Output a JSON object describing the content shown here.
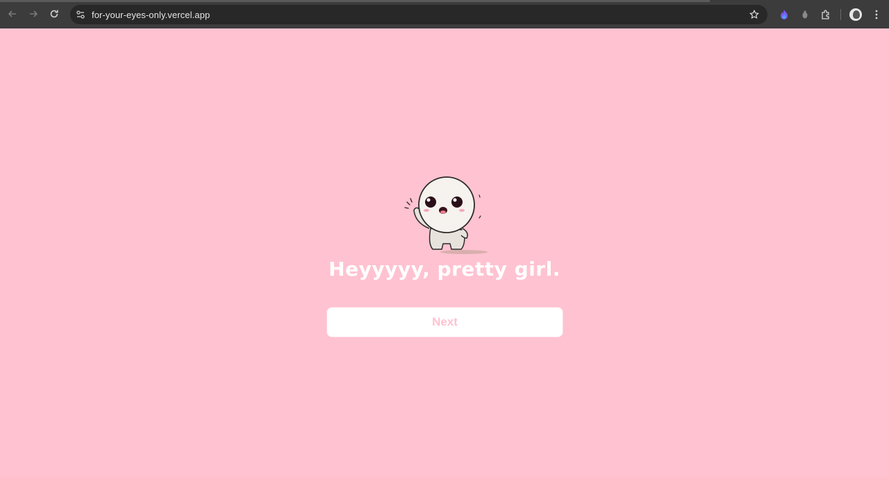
{
  "browser": {
    "url": "for-your-eyes-only.vercel.app",
    "icons": [
      "back-arrow-icon",
      "forward-arrow-icon",
      "reload-icon",
      "site-info-icon",
      "bookmark-star-icon",
      "extension-flame-icon",
      "extension-gray-icon",
      "extensions-puzzle-icon",
      "profile-avatar-icon",
      "more-menu-icon"
    ]
  },
  "page": {
    "headline": "Heyyyyy, pretty girl.",
    "next_label": "Next"
  },
  "colors": {
    "background": "#ffc2d1",
    "headline": "#ffffff",
    "button_bg": "#ffffff",
    "button_text": "#ffc2d1",
    "browser_bar": "#3c3c3c"
  }
}
